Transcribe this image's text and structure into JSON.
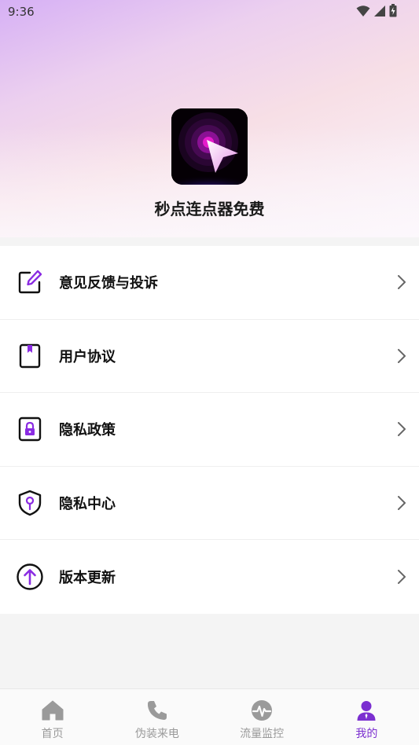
{
  "status_bar": {
    "time": "9:36"
  },
  "app": {
    "name": "秒点连点器免费"
  },
  "menu": {
    "items": [
      {
        "label": "意见反馈与投诉",
        "icon": "edit-icon"
      },
      {
        "label": "用户协议",
        "icon": "book-icon"
      },
      {
        "label": "隐私政策",
        "icon": "lock-icon"
      },
      {
        "label": "隐私中心",
        "icon": "shield-icon"
      },
      {
        "label": "版本更新",
        "icon": "arrow-up-circle-icon"
      }
    ]
  },
  "tabbar": {
    "tabs": [
      {
        "label": "首页",
        "icon": "home-icon",
        "active": false
      },
      {
        "label": "伪装来电",
        "icon": "phone-icon",
        "active": false
      },
      {
        "label": "流量监控",
        "icon": "pulse-icon",
        "active": false
      },
      {
        "label": "我的",
        "icon": "user-icon",
        "active": true
      }
    ]
  },
  "colors": {
    "accent": "#7b2fd0",
    "inactive": "#9a9a9a"
  }
}
